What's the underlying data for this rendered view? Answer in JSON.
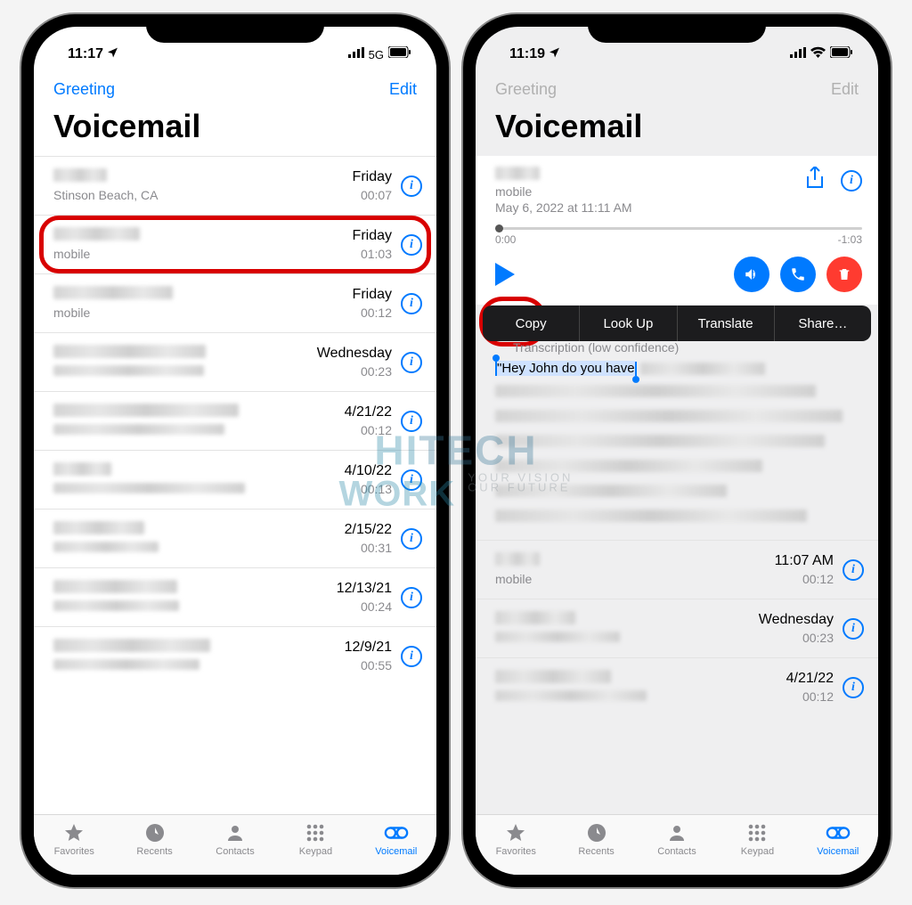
{
  "left": {
    "status": {
      "time": "11:17",
      "carrier": "5G"
    },
    "nav": {
      "greeting": "Greeting",
      "edit": "Edit"
    },
    "title": "Voicemail",
    "items": [
      {
        "sub": "Stinson Beach, CA",
        "date": "Friday",
        "dur": "00:07"
      },
      {
        "sub": "mobile",
        "date": "Friday",
        "dur": "01:03",
        "highlighted": true
      },
      {
        "sub": "mobile",
        "date": "Friday",
        "dur": "00:12"
      },
      {
        "sub": "",
        "date": "Wednesday",
        "dur": "00:23"
      },
      {
        "sub": "",
        "date": "4/21/22",
        "dur": "00:12"
      },
      {
        "sub": "",
        "date": "4/10/22",
        "dur": "00:13"
      },
      {
        "sub": "",
        "date": "2/15/22",
        "dur": "00:31"
      },
      {
        "sub": "",
        "date": "12/13/21",
        "dur": "00:24"
      },
      {
        "sub": "",
        "date": "12/9/21",
        "dur": "00:55"
      }
    ]
  },
  "right": {
    "status": {
      "time": "11:19"
    },
    "nav": {
      "greeting": "Greeting",
      "edit": "Edit"
    },
    "title": "Voicemail",
    "detail": {
      "sub": "mobile",
      "date": "May 6, 2022 at 11:11 AM",
      "elapsed": "0:00",
      "remaining": "-1:03",
      "transcript_label": "Transcription (low confidence)",
      "transcript_selected": "\"Hey John do you have"
    },
    "context_menu": [
      "Copy",
      "Look Up",
      "Translate",
      "Share…"
    ],
    "lower_items": [
      {
        "sub": "mobile",
        "date": "11:07 AM",
        "dur": "00:12"
      },
      {
        "sub": "",
        "date": "Wednesday",
        "dur": "00:23"
      },
      {
        "sub": "",
        "date": "4/21/22",
        "dur": "00:12"
      }
    ]
  },
  "tabs": [
    {
      "label": "Favorites"
    },
    {
      "label": "Recents"
    },
    {
      "label": "Contacts"
    },
    {
      "label": "Keypad"
    },
    {
      "label": "Voicemail",
      "active": true
    }
  ],
  "watermark": {
    "line1_a": "HI",
    "line1_b": "TECH",
    "line2": "WORK",
    "line3a": "YOUR VISION",
    "line3b": "OUR FUTURE"
  }
}
